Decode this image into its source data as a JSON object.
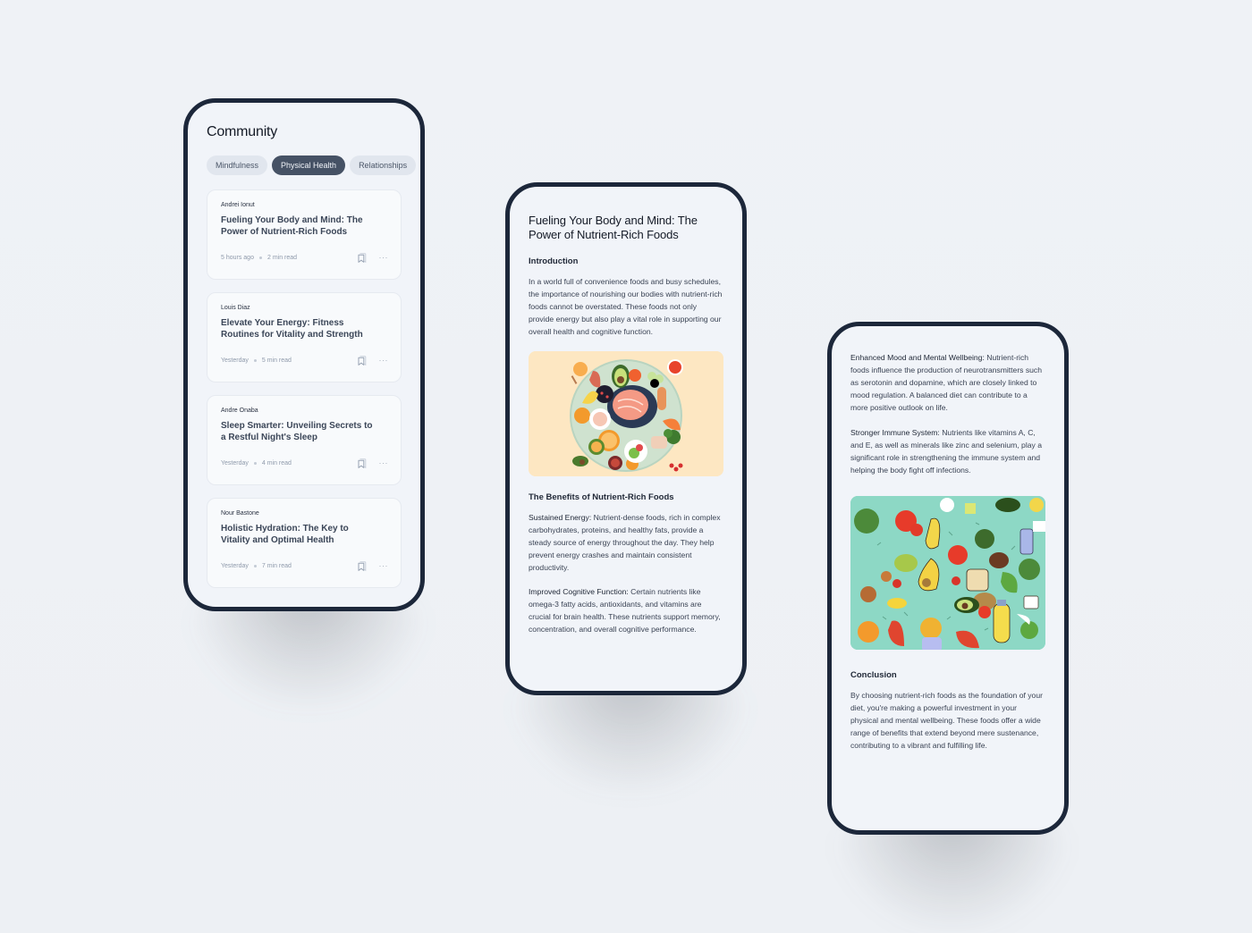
{
  "community": {
    "title": "Community",
    "chips": [
      {
        "label": "Mindfulness",
        "active": false
      },
      {
        "label": "Physical Health",
        "active": true
      },
      {
        "label": "Relationships",
        "active": false
      }
    ],
    "posts": [
      {
        "author": "Andrei Ionut",
        "title": "Fueling Your Body and Mind: The Power of Nutrient-Rich Foods",
        "time": "5 hours ago",
        "read_time": "2 min read",
        "bookmark_icon": "bookmark-icon",
        "more_icon": "more-horizontal-icon"
      },
      {
        "author": "Louis Diaz",
        "title": "Elevate Your Energy: Fitness Routines for Vitality and Strength",
        "time": "Yesterday",
        "read_time": "5 min read",
        "bookmark_icon": "bookmark-icon",
        "more_icon": "more-horizontal-icon"
      },
      {
        "author": "Andre Onaba",
        "title": "Sleep Smarter: Unveiling Secrets to a Restful Night's Sleep",
        "time": "Yesterday",
        "read_time": "4 min read",
        "bookmark_icon": "bookmark-icon",
        "more_icon": "more-horizontal-icon"
      },
      {
        "author": "Nour Bastone",
        "title": "Holistic Hydration: The Key to Vitality and Optimal Health",
        "time": "Yesterday",
        "read_time": "7 min read",
        "bookmark_icon": "bookmark-icon",
        "more_icon": "more-horizontal-icon"
      }
    ]
  },
  "article": {
    "title": "Fueling Your Body and Mind: The Power of Nutrient-Rich Foods",
    "intro_heading": "Introduction",
    "intro_text": "In a world full of convenience foods and busy schedules, the importance of nourishing our bodies with nutrient-rich foods cannot be overstated. These foods not only provide energy but also play a vital role in supporting our overall health and cognitive function.",
    "hero_image": "food-plate-illustration",
    "benefits_heading": "The Benefits of Nutrient-Rich Foods",
    "benefits": [
      {
        "label": "Sustained Energy:",
        "text": " Nutrient-dense foods, rich in complex carbohydrates, proteins, and healthy fats, provide a steady source of energy throughout the day. They help prevent energy crashes and maintain consistent productivity."
      },
      {
        "label": "Improved Cognitive Function:",
        "text": " Certain nutrients like omega-3 fatty acids, antioxidants, and vitamins are crucial for brain health. These nutrients support memory, concentration, and overall cognitive performance."
      },
      {
        "label": "Enhanced Mood and Mental Wellbeing:",
        "text": " Nutrient-rich foods influence the production of neurotransmitters such as serotonin and dopamine, which are closely linked to mood regulation. A balanced diet can contribute to a more positive outlook on life."
      },
      {
        "label": "Stronger Immune System:",
        "text": " Nutrients like vitamins A, C, and E, as well as minerals like zinc and selenium, play a significant role in strengthening the immune system and helping the body fight off infections."
      }
    ],
    "pattern_image": "food-pattern-illustration",
    "conclusion_heading": "Conclusion",
    "conclusion_text": "By choosing nutrient-rich foods as the foundation of your diet, you're making a powerful investment in your physical and mental wellbeing. These foods offer a wide range of benefits that extend beyond mere sustenance, contributing to a vibrant and fulfilling life."
  },
  "colors": {
    "background": "#eef1f5",
    "phone_frame": "#1c273a",
    "screen": "#f1f4f9",
    "chip_active": "#465265",
    "chip": "#e1e6ee",
    "card": "#f8fafc",
    "meta_text": "#8f9aab",
    "plate_bg": "#fde7c2",
    "pattern_bg": "#8dd8c5"
  }
}
